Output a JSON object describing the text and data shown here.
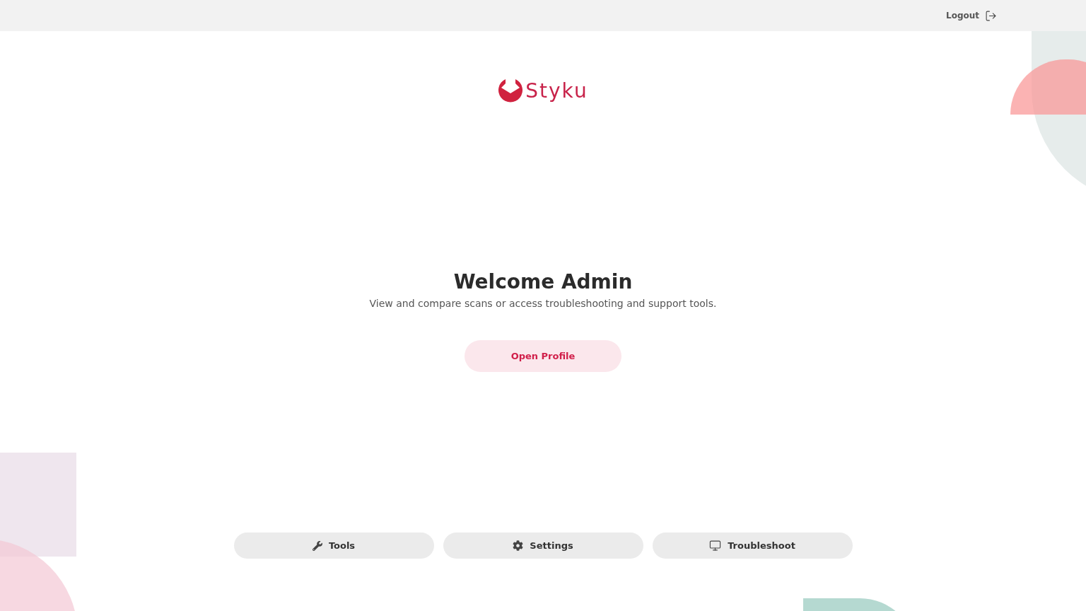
{
  "header": {
    "logout": "Logout"
  },
  "logo": {
    "text": "Styku"
  },
  "welcome": {
    "title": "Welcome Admin",
    "subtitle": "View and compare scans or access troubleshooting and support tools."
  },
  "primary_button": "Open Profile",
  "actions": [
    {
      "label": "Tools",
      "kind": "wrench"
    },
    {
      "label": "Settings",
      "kind": "gear"
    },
    {
      "label": "Troubleshoot",
      "kind": "monitor"
    }
  ]
}
